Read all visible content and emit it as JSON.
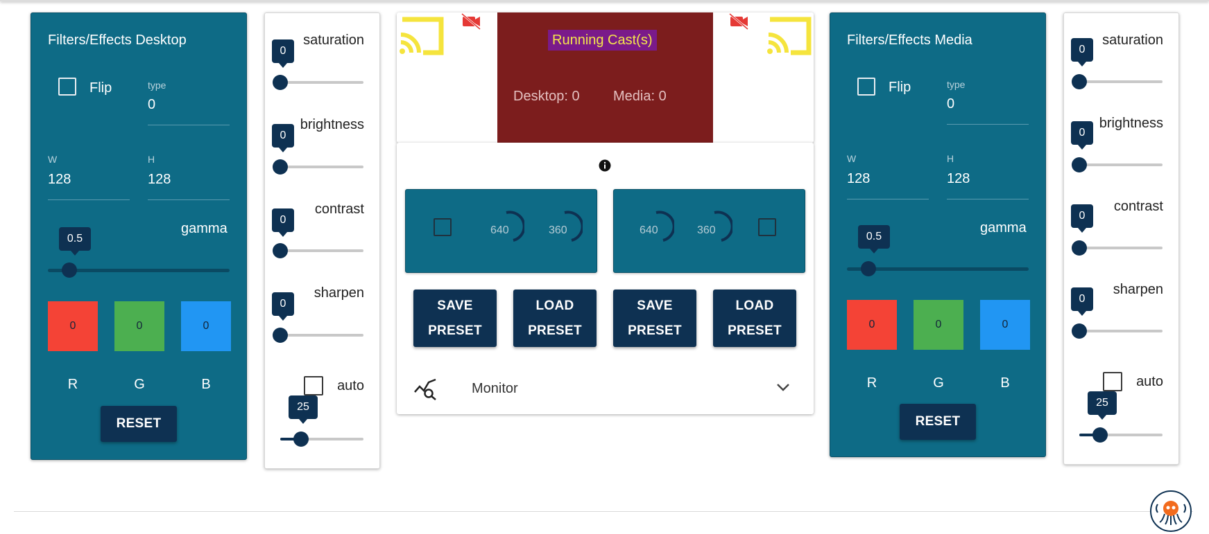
{
  "desktop": {
    "title": "Filters/Effects Desktop",
    "flip_label": "Flip",
    "type_label": "type",
    "type_value": "0",
    "w_label": "W",
    "w_value": "128",
    "h_label": "H",
    "h_value": "128",
    "gamma_label": "gamma",
    "gamma_value": "0.5",
    "r_value": "0",
    "g_value": "0",
    "b_value": "0",
    "r_label": "R",
    "g_label": "G",
    "b_label": "B",
    "reset_label": "RESET"
  },
  "desktop_adjust": {
    "saturation_label": "saturation",
    "saturation_value": "0",
    "brightness_label": "brightness",
    "brightness_value": "0",
    "contrast_label": "contrast",
    "contrast_value": "0",
    "sharpen_label": "sharpen",
    "sharpen_value": "0",
    "auto_label": "auto",
    "auto_value": "25"
  },
  "cast": {
    "title": "Running Cast(s)",
    "desktop_count": "Desktop: 0",
    "media_count": "Media: 0"
  },
  "presets": {
    "left_width": "640",
    "left_height": "360",
    "right_width": "640",
    "right_height": "360",
    "save_label_1": "SAVE",
    "save_label_2": "PRESET",
    "load_label_1": "LOAD",
    "load_label_2": "PRESET"
  },
  "monitor": {
    "label": "Monitor"
  },
  "media": {
    "title": "Filters/Effects Media",
    "flip_label": "Flip",
    "type_label": "type",
    "type_value": "0",
    "w_label": "W",
    "w_value": "128",
    "h_label": "H",
    "h_value": "128",
    "gamma_label": "gamma",
    "gamma_value": "0.5",
    "r_value": "0",
    "g_value": "0",
    "b_value": "0",
    "r_label": "R",
    "g_label": "G",
    "b_label": "B",
    "reset_label": "RESET"
  },
  "media_adjust": {
    "saturation_label": "saturation",
    "saturation_value": "0",
    "brightness_label": "brightness",
    "brightness_value": "0",
    "contrast_label": "contrast",
    "contrast_value": "0",
    "sharpen_label": "sharpen",
    "sharpen_value": "0",
    "auto_label": "auto",
    "auto_value": "25"
  },
  "colors": {
    "panel_teal": "#0e6b86",
    "navy": "#0e3152",
    "red_swatch": "#f44336",
    "green_swatch": "#4caf50",
    "blue_swatch": "#2196f3",
    "cast_yellow": "#f5e43d",
    "running_bg": "#7c1d1d"
  },
  "icons": {
    "cast_left": "cast-icon",
    "cast_right": "cast-icon",
    "cast_off_left": "video-off-icon",
    "cast_off_right": "video-off-icon",
    "info": "info-icon",
    "monitor": "analytics-icon",
    "expand": "chevron-down-icon",
    "logo": "octopus-logo"
  }
}
